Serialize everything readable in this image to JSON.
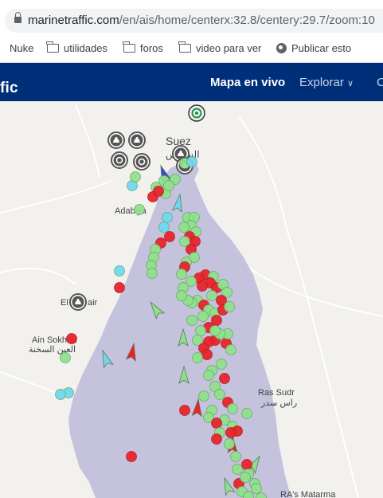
{
  "browser": {
    "url_host": "marinetraffic.com",
    "url_path": "/en/ais/home/centerx:32.8/centery:29.7/zoom:10",
    "bookmarks": [
      "Nuke",
      "utilidades",
      "foros",
      "video para ver",
      "Publicar esto"
    ]
  },
  "header": {
    "brand": "fic",
    "nav": {
      "live_map": "Mapa en vivo",
      "explore": "Explorar",
      "more": "C"
    }
  },
  "map": {
    "place_labels": {
      "suez": "Suez",
      "suez_ar": "السويس",
      "adabiya": "Adabiya",
      "el_sokhna": "El",
      "el_sokhna_tail": "air",
      "ain_sokhna": "Ain Sokhna",
      "ain_sokhna_ar": "العين السخنة",
      "ras_sudr": "Ras Sudr",
      "ras_sudr_ar": "راس سدر",
      "ras_matarma": "RA's Matarma"
    },
    "colors": {
      "water": "#c4c2dd",
      "land": "#f2f1ee",
      "cargo_green": "#8fe08a",
      "tanker_red": "#e8242a",
      "passenger_cyan": "#6fd8ee",
      "port_icon": "#555555"
    }
  }
}
